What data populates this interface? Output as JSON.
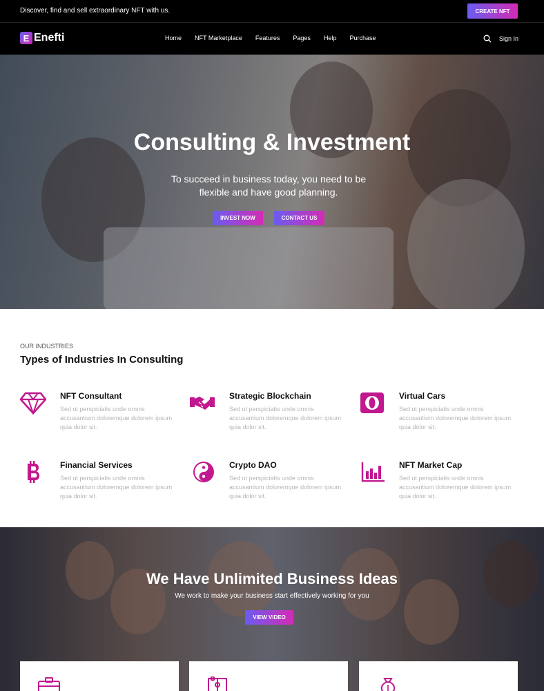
{
  "topbar": {
    "message": "Discover, find and sell extraordinary NFT with us.",
    "create_label": "CREATE NFT"
  },
  "brand": {
    "mark": "E",
    "name": "Enefti"
  },
  "nav": {
    "items": [
      "Home",
      "NFT Marketplace",
      "Features",
      "Pages",
      "Help",
      "Purchase"
    ],
    "search_icon": "search-icon",
    "signin": "Sign In"
  },
  "hero": {
    "title": "Consulting & Investment",
    "subtitle": "To succeed in business today, you need to be flexible and have good planning.",
    "invest_label": "INVEST NOW",
    "contact_label": "CONTACT US"
  },
  "industries": {
    "kicker": "OUR INDUSTRIES",
    "title": "Types of Industries In Consulting",
    "items": [
      {
        "name": "NFT Consultant",
        "desc": "Sed ut perspiciatis unde omnis accusantium doloremque dolorem ipsum quia dolor sit.",
        "icon": "diamond-icon"
      },
      {
        "name": "Strategic Blockchain",
        "desc": "Sed ut perspiciatis unde omnis accusantium doloremque dolorem ipsum quia dolor sit.",
        "icon": "handshake-icon"
      },
      {
        "name": "Virtual Cars",
        "desc": "Sed ut perspiciatis unde omnis accusantium doloremque dolorem ipsum quia dolor sit.",
        "icon": "card-icon"
      },
      {
        "name": "Financial Services",
        "desc": "Sed ut perspiciatis unde omnis accusantium doloremque dolorem ipsum quia dolor sit.",
        "icon": "bitcoin-icon"
      },
      {
        "name": "Crypto DAO",
        "desc": "Sed ut perspiciatis unde omnis accusantium doloremque dolorem ipsum quia dolor sit.",
        "icon": "yin-yang-icon"
      },
      {
        "name": "NFT Market Cap",
        "desc": "Sed ut perspiciatis unde omnis accusantium doloremque dolorem ipsum quia dolor sit.",
        "icon": "bar-chart-icon"
      }
    ]
  },
  "ideas": {
    "title": "We Have Unlimited Business Ideas",
    "subtitle": "We work to make your business start effectively working for you",
    "video_label": "VIEW VIDEO"
  },
  "cards": [
    {
      "icon": "briefcase-icon"
    },
    {
      "icon": "puzzle-icon"
    },
    {
      "icon": "money-bag-icon"
    }
  ],
  "colors": {
    "accent_start": "#6a5cf0",
    "accent_end": "#d42bb4",
    "icon": "#c2188f",
    "dark": "#000000"
  }
}
